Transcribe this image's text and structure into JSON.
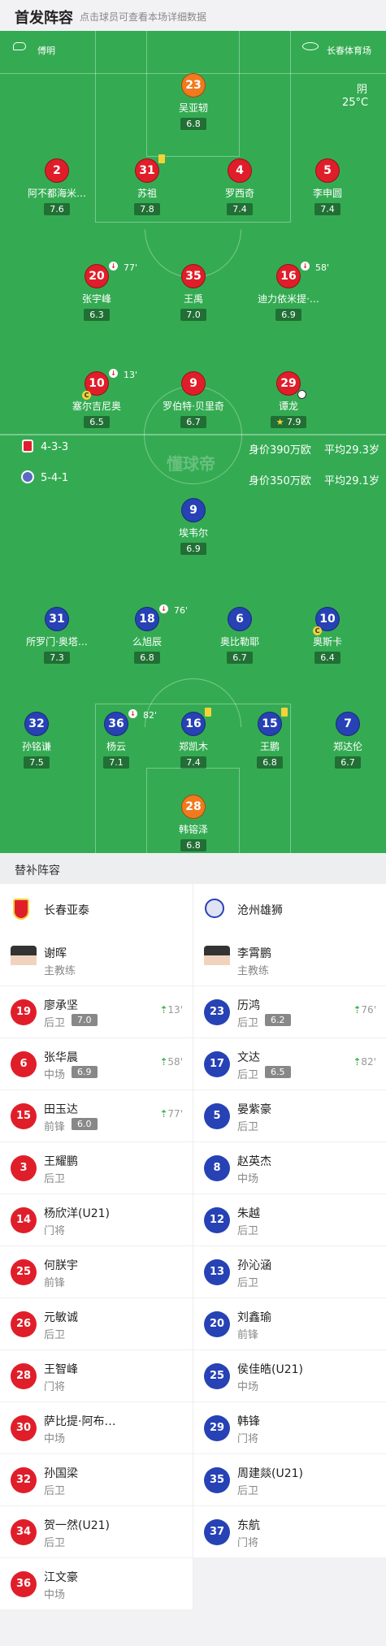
{
  "header": {
    "title": "首发阵容",
    "subtitle": "点击球员可查看本场详细数据"
  },
  "pitch": {
    "referee": "傅明",
    "venue": "长春体育场",
    "weather": "阴",
    "temperature": "25°C",
    "watermark": "懂球帝",
    "home_formation": "4-3-3",
    "home_value": "身价390万欧",
    "home_age": "平均29.3岁",
    "away_formation": "5-4-1",
    "away_value": "身价350万欧",
    "away_age": "平均29.1岁"
  },
  "home_players": [
    {
      "num": "23",
      "name": "吴亚轫",
      "rating": "6.8"
    },
    {
      "num": "2",
      "name": "阿不都海米…",
      "rating": "7.6"
    },
    {
      "num": "31",
      "name": "苏祖",
      "rating": "7.8"
    },
    {
      "num": "4",
      "name": "罗西奇",
      "rating": "7.4"
    },
    {
      "num": "5",
      "name": "李申圆",
      "rating": "7.4"
    },
    {
      "num": "20",
      "name": "张宇峰",
      "rating": "6.3",
      "sub_time": "77'"
    },
    {
      "num": "35",
      "name": "王禹",
      "rating": "7.0"
    },
    {
      "num": "16",
      "name": "迪力依米提·…",
      "rating": "6.9",
      "sub_time": "58'"
    },
    {
      "num": "10",
      "name": "塞尔吉尼奥",
      "rating": "6.5",
      "sub_time": "13'"
    },
    {
      "num": "9",
      "name": "罗伯特·贝里奇",
      "rating": "6.7"
    },
    {
      "num": "29",
      "name": "谭龙",
      "rating": "7.9"
    }
  ],
  "away_players": [
    {
      "num": "9",
      "name": "埃韦尔",
      "rating": "6.9"
    },
    {
      "num": "31",
      "name": "所罗门·奥塔…",
      "rating": "7.3"
    },
    {
      "num": "18",
      "name": "么旭辰",
      "rating": "6.8",
      "sub_time": "76'"
    },
    {
      "num": "6",
      "name": "奥比勒耶",
      "rating": "6.7"
    },
    {
      "num": "10",
      "name": "奥斯卡",
      "rating": "6.4"
    },
    {
      "num": "32",
      "name": "孙铭谦",
      "rating": "7.5"
    },
    {
      "num": "36",
      "name": "杨云",
      "rating": "7.1",
      "sub_time": "82'"
    },
    {
      "num": "16",
      "name": "郑凯木",
      "rating": "7.4"
    },
    {
      "num": "15",
      "name": "王鹏",
      "rating": "6.8"
    },
    {
      "num": "7",
      "name": "郑达伦",
      "rating": "6.7"
    },
    {
      "num": "28",
      "name": "韩镕泽",
      "rating": "6.8"
    }
  ],
  "subs": {
    "title": "替补阵容",
    "home_team": "长春亚泰",
    "away_team": "沧州雄狮",
    "home": [
      {
        "name": "谢晖",
        "pos": "主教练"
      },
      {
        "num": "19",
        "name": "廖承坚",
        "pos": "后卫",
        "rating": "7.0",
        "time": "13'"
      },
      {
        "num": "6",
        "name": "张华晨",
        "pos": "中场",
        "rating": "6.9",
        "time": "58'"
      },
      {
        "num": "15",
        "name": "田玉达",
        "pos": "前锋",
        "rating": "6.0",
        "time": "77'"
      },
      {
        "num": "3",
        "name": "王耀鹏",
        "pos": "后卫"
      },
      {
        "num": "14",
        "name": "杨欣洋(U21)",
        "pos": "门将"
      },
      {
        "num": "25",
        "name": "何朕宇",
        "pos": "前锋"
      },
      {
        "num": "26",
        "name": "元敏诚",
        "pos": "后卫"
      },
      {
        "num": "28",
        "name": "王智峰",
        "pos": "门将"
      },
      {
        "num": "30",
        "name": "萨比提·阿布…",
        "pos": "中场"
      },
      {
        "num": "32",
        "name": "孙国梁",
        "pos": "后卫"
      },
      {
        "num": "34",
        "name": "贺一然(U21)",
        "pos": "后卫"
      },
      {
        "num": "36",
        "name": "江文豪",
        "pos": "中场"
      }
    ],
    "away": [
      {
        "name": "李霄鹏",
        "pos": "主教练"
      },
      {
        "num": "23",
        "name": "历鸿",
        "pos": "后卫",
        "rating": "6.2",
        "time": "76'"
      },
      {
        "num": "17",
        "name": "文达",
        "pos": "后卫",
        "rating": "6.5",
        "time": "82'"
      },
      {
        "num": "5",
        "name": "晏紫豪",
        "pos": "后卫"
      },
      {
        "num": "8",
        "name": "赵英杰",
        "pos": "中场"
      },
      {
        "num": "12",
        "name": "朱越",
        "pos": "后卫"
      },
      {
        "num": "13",
        "name": "孙沁涵",
        "pos": "后卫"
      },
      {
        "num": "20",
        "name": "刘鑫瑜",
        "pos": "前锋"
      },
      {
        "num": "25",
        "name": "侯佳皓(U21)",
        "pos": "中场"
      },
      {
        "num": "29",
        "name": "韩锋",
        "pos": "门将"
      },
      {
        "num": "35",
        "name": "周建燚(U21)",
        "pos": "后卫"
      },
      {
        "num": "37",
        "name": "东航",
        "pos": "门将"
      }
    ]
  },
  "colors": {
    "pitch": "#34ab52",
    "home": "#e01e2a",
    "away": "#2742b5",
    "gk": "#f07a1d"
  }
}
